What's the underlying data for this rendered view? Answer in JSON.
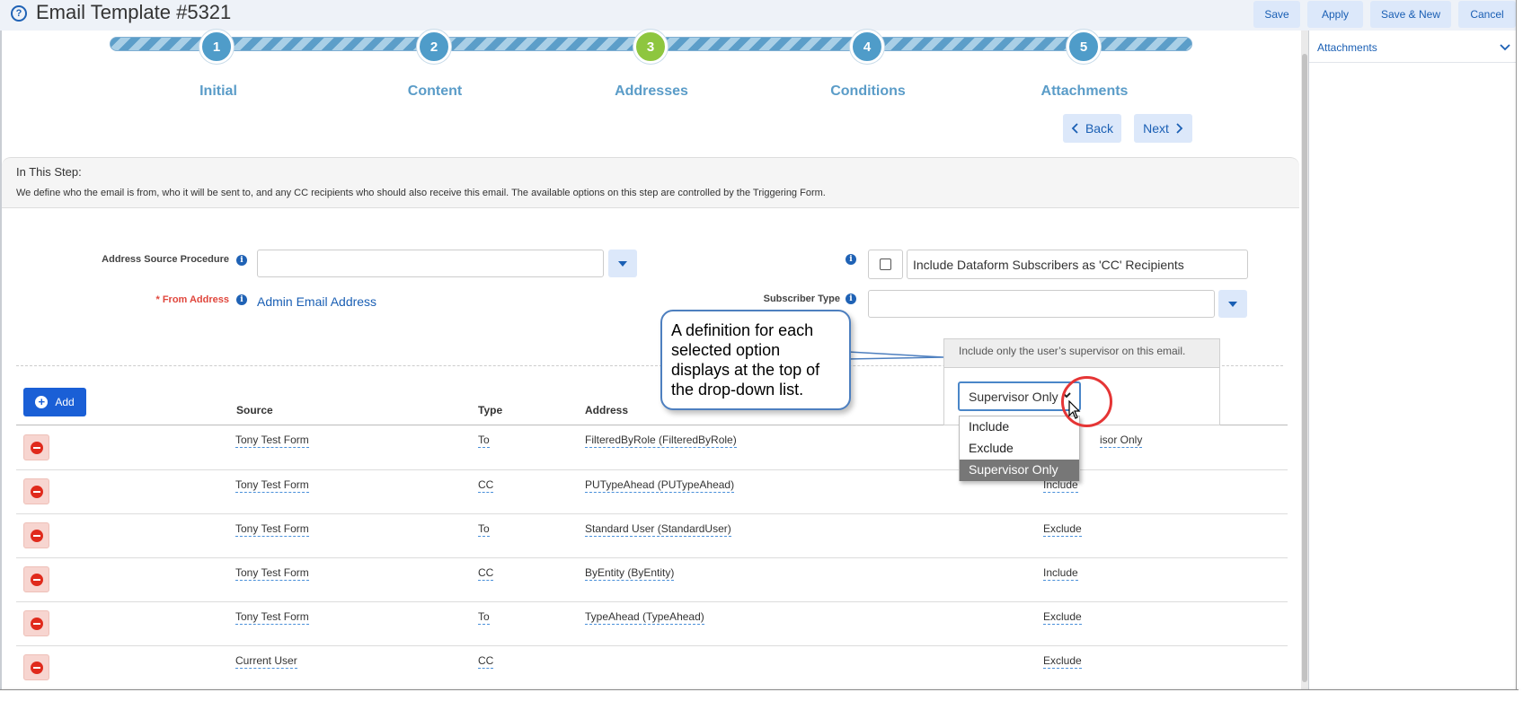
{
  "header": {
    "title": "Email Template #5321",
    "buttons": {
      "save": "Save",
      "apply": "Apply",
      "save_new": "Save & New",
      "cancel": "Cancel"
    }
  },
  "right_panel": {
    "title": "Attachments"
  },
  "stepper": {
    "steps": [
      {
        "number": "1",
        "label": "Initial",
        "color": "#4f9cc9"
      },
      {
        "number": "2",
        "label": "Content",
        "color": "#4f9cc9"
      },
      {
        "number": "3",
        "label": "Addresses",
        "color": "#8ec63f"
      },
      {
        "number": "4",
        "label": "Conditions",
        "color": "#4f9cc9"
      },
      {
        "number": "5",
        "label": "Attachments",
        "color": "#4f9cc9"
      }
    ],
    "current_step": 3,
    "back_label": "Back",
    "next_label": "Next"
  },
  "info": {
    "title": "In This Step:",
    "text": "We define who the email is from, who it will be sent to, and any CC recipients who should also receive this email. The available options on this step are controlled by the Triggering Form."
  },
  "form": {
    "address_source_label": "Address Source Procedure",
    "address_source_value": "",
    "from_address_required": "* From Address",
    "from_address_value": "Admin Email Address",
    "include_subscribers_label": "Include Dataform Subscribers as 'CC' Recipients",
    "include_subscribers_checked": false,
    "subscriber_type_label": "Subscriber Type",
    "subscriber_type_value": ""
  },
  "table": {
    "add_label": "Add",
    "columns": [
      "Source",
      "Type",
      "Address"
    ],
    "rows": [
      {
        "source": "Tony Test Form",
        "type": "To",
        "address": "FilteredByRole (FilteredByRole)",
        "supervisor": "Supervisor Only",
        "supervisor_visible": "isor Only"
      },
      {
        "source": "Tony Test Form",
        "type": "CC",
        "address": "PUTypeAhead (PUTypeAhead)",
        "supervisor": "Include"
      },
      {
        "source": "Tony Test Form",
        "type": "To",
        "address": "Standard User (StandardUser)",
        "supervisor": "Exclude"
      },
      {
        "source": "Tony Test Form",
        "type": "CC",
        "address": "ByEntity (ByEntity)",
        "supervisor": "Include"
      },
      {
        "source": "Tony Test Form",
        "type": "To",
        "address": "TypeAhead (TypeAhead)",
        "supervisor": "Exclude"
      },
      {
        "source": "Current User",
        "type": "CC",
        "address": "",
        "supervisor": "Exclude"
      }
    ]
  },
  "popup": {
    "definition": "Include only the user’s supervisor on this email.",
    "selected": "Supervisor Only",
    "options": [
      "Include",
      "Exclude",
      "Supervisor Only"
    ]
  },
  "callout": {
    "text": "A definition for each selected option displays at the top of the drop-down list."
  },
  "colors": {
    "accent": "#1a5fb4",
    "button_bg": "#dce8fa",
    "step_active": "#8ec63f",
    "step_default": "#4f9cc9",
    "required": "#e0463c",
    "highlight_circle": "#e53535"
  }
}
